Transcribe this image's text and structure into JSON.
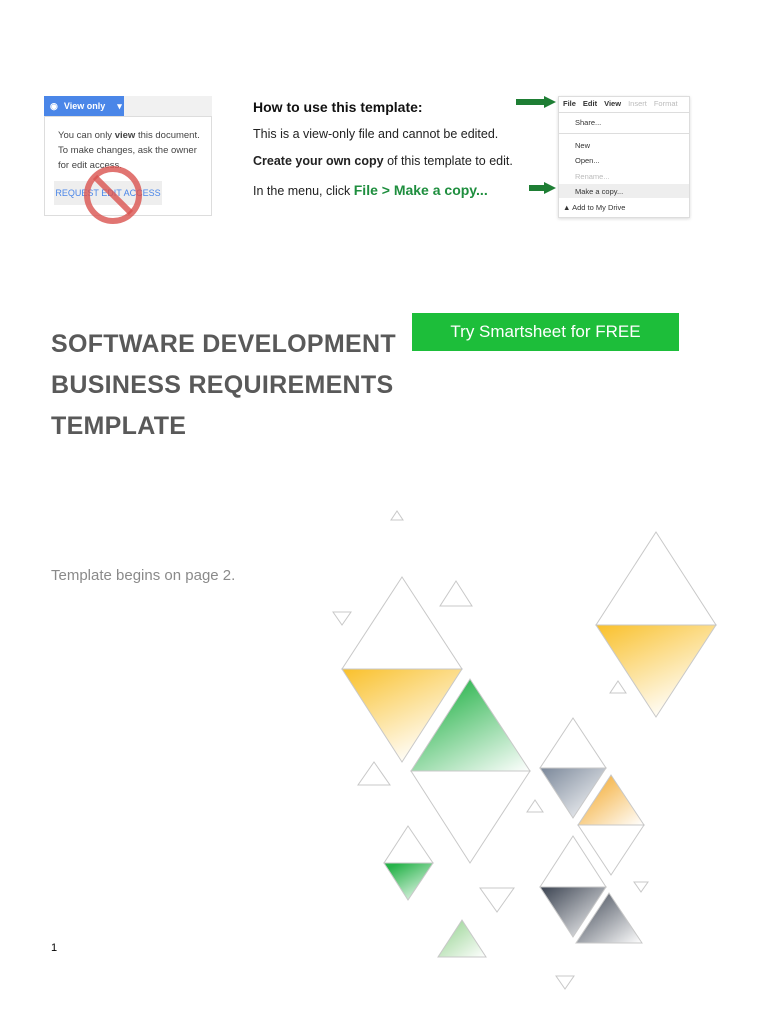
{
  "view_only_box": {
    "button_label": "View only",
    "message_prefix": "You can only ",
    "message_bold": "view",
    "message_suffix": " this document. To make changes, ask the owner for edit access.",
    "request_label": "REQUEST EDIT ACCESS"
  },
  "instructions": {
    "heading": "How to use this template:",
    "line1": "This is a view-only file and cannot be edited.",
    "line2_bold": "Create your own copy",
    "line2_rest": " of this template to edit.",
    "line3_prefix": "In the menu, click ",
    "line3_green": "File > Make a copy..."
  },
  "file_menu": {
    "bar": [
      "File",
      "Edit",
      "View",
      "Insert",
      "Format"
    ],
    "items": [
      "Share...",
      "New",
      "Open...",
      "Rename...",
      "Make a copy...",
      "Add to My Drive"
    ]
  },
  "title_lines": [
    "SOFTWARE DEVELOPMENT",
    "BUSINESS REQUIREMENTS",
    "TEMPLATE"
  ],
  "cta_label": "Try Smartsheet for FREE",
  "begins_text": "Template begins on page 2.",
  "page_number": "1",
  "colors": {
    "cta": "#1dbe3a",
    "title": "#595959",
    "accent_green": "#1e8e3e"
  }
}
